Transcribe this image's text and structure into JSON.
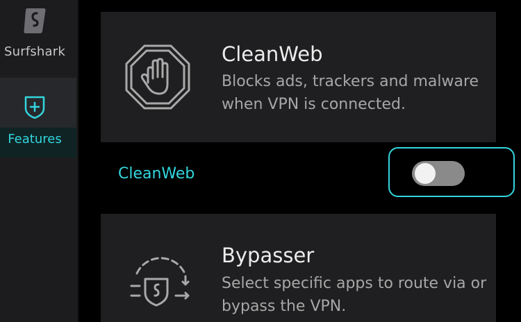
{
  "brand": {
    "name": "Surfshark"
  },
  "sidebar": {
    "items": [
      {
        "label": "Features",
        "icon": "shield-plus-icon",
        "selected": true
      }
    ]
  },
  "features": [
    {
      "title": "CleanWeb",
      "description": "Blocks ads, trackers and malware when VPN is connected.",
      "icon": "stop-hand-icon"
    },
    {
      "title": "Bypasser",
      "description": "Select specific apps to route via or bypass the VPN.",
      "icon": "bypasser-shield-icon"
    }
  ],
  "cleanweb_toggle": {
    "label": "CleanWeb",
    "enabled": false
  },
  "colors": {
    "accent": "#33d6de",
    "card_bg": "#1f1f21",
    "sidebar_bg": "#1c1c1e",
    "toggle_off": "#8a8a8a"
  }
}
